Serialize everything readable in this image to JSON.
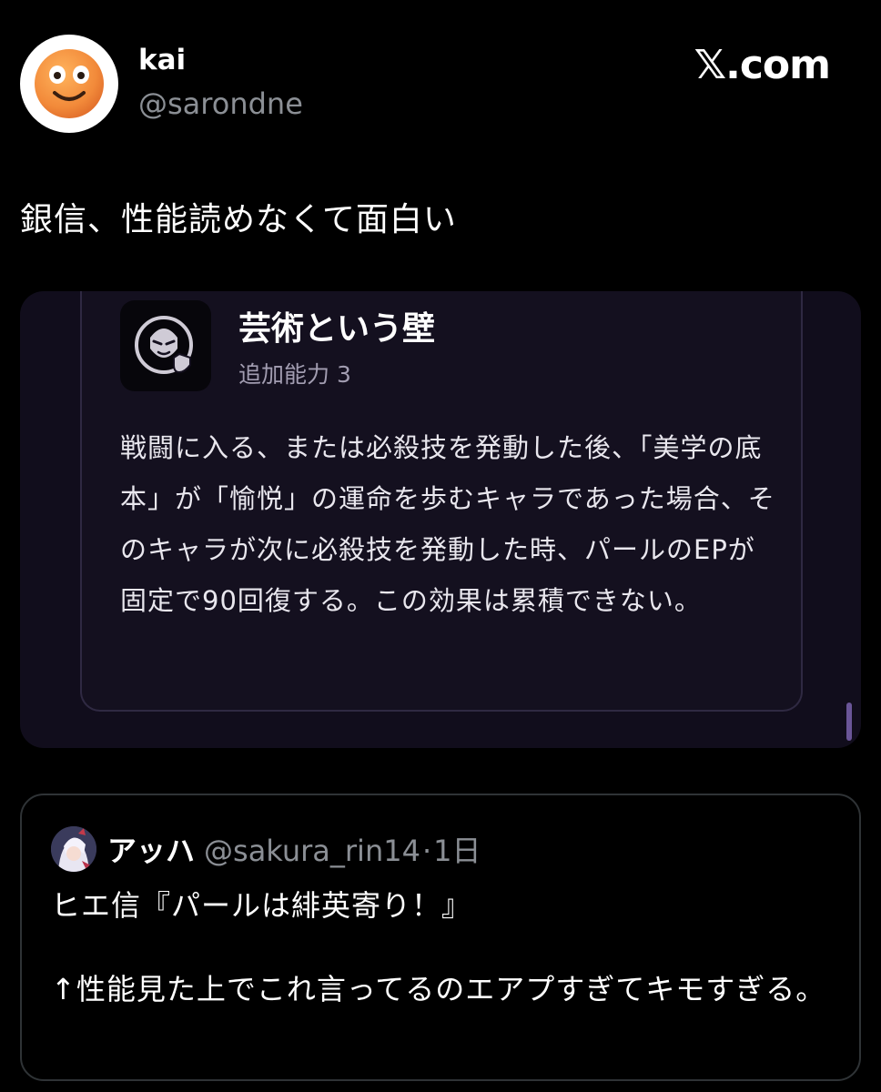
{
  "colors": {
    "background": "#000000",
    "text_primary": "#ffffff",
    "text_secondary": "#8b8f95",
    "card_border": "#2f3336",
    "media_background": "#110d1c",
    "ability_card_border": "#2f2942",
    "scroll_accent": "#6a5598"
  },
  "author": {
    "name": "kai",
    "handle": "@sarondne",
    "avatar_icon": "smiling-face-emoji-icon"
  },
  "site": {
    "logo": "𝕏.com"
  },
  "tweet": {
    "text": "銀信、性能読めなくて面白い"
  },
  "media": {
    "ability": {
      "icon": "masked-figure-shield-icon",
      "title": "芸術という壁",
      "subtitle": "追加能力 3",
      "description": "戦闘に入る、または必殺技を発動した後、「美学の底本」が「愉悦」の運命を歩むキャラであった場合、そのキャラが次に必殺技を発動した時、パールのEPが固定で90回復する。この効果は累積できない。"
    }
  },
  "quote": {
    "avatar_icon": "anime-character-avatar-icon",
    "name": "アッハ",
    "handle": "@sakura_rin14",
    "separator": "·",
    "time": "1日",
    "text": "ヒエ信『パールは緋英寄り！』\n\n↑性能見た上でこれ言ってるのエアプすぎてキモすぎる。"
  }
}
